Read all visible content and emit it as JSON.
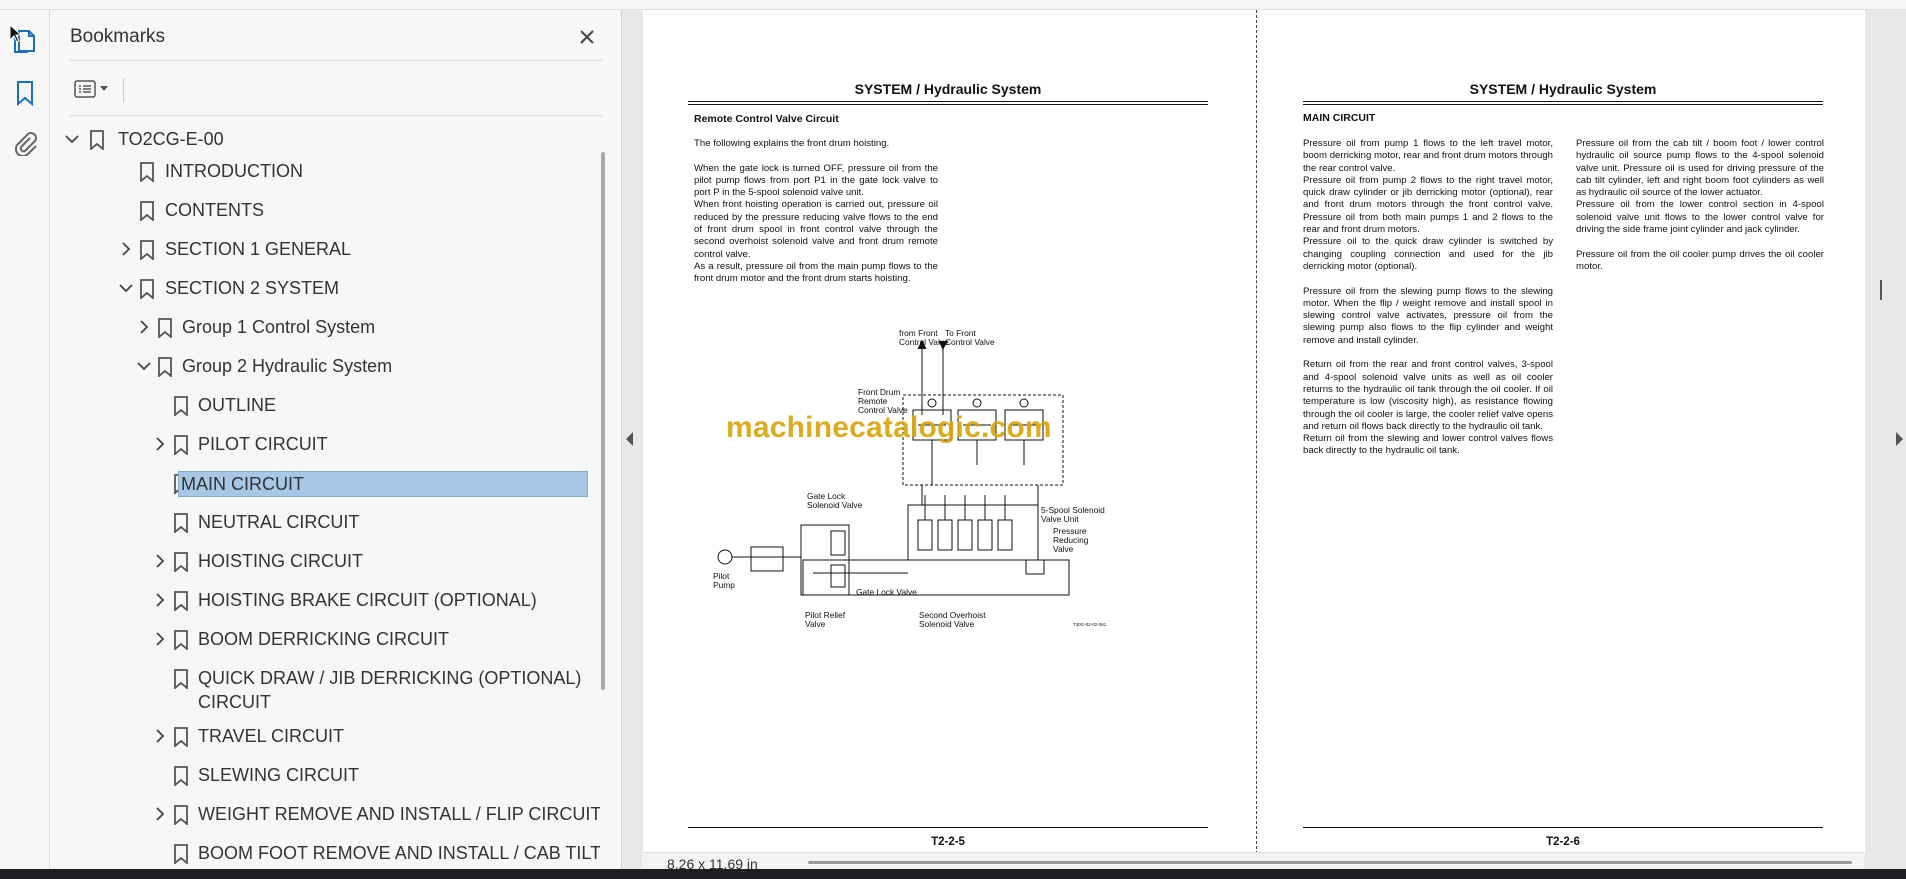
{
  "sidebar_panel": {
    "title": "Bookmarks",
    "root": "TO2CG-E-00",
    "items": [
      {
        "label": "INTRODUCTION",
        "level": 1,
        "expander": "none"
      },
      {
        "label": "CONTENTS",
        "level": 1,
        "expander": "none"
      },
      {
        "label": "SECTION 1 GENERAL",
        "level": 1,
        "expander": "collapsed"
      },
      {
        "label": "SECTION 2 SYSTEM",
        "level": 1,
        "expander": "expanded"
      },
      {
        "label": "Group 1 Control System",
        "level": 2,
        "expander": "collapsed"
      },
      {
        "label": "Group 2 Hydraulic System",
        "level": 2,
        "expander": "expanded"
      },
      {
        "label": "OUTLINE",
        "level": 3,
        "expander": "none"
      },
      {
        "label": "PILOT CIRCUIT",
        "level": 3,
        "expander": "collapsed"
      },
      {
        "label": "MAIN CIRCUIT",
        "level": 3,
        "expander": "none",
        "selected": true
      },
      {
        "label": "NEUTRAL CIRCUIT",
        "level": 3,
        "expander": "none"
      },
      {
        "label": "HOISTING CIRCUIT",
        "level": 3,
        "expander": "collapsed"
      },
      {
        "label": "HOISTING BRAKE CIRCUIT (OPTIONAL)",
        "level": 3,
        "expander": "collapsed"
      },
      {
        "label": "BOOM DERRICKING CIRCUIT",
        "level": 3,
        "expander": "collapsed"
      },
      {
        "label": "QUICK DRAW / JIB DERRICKING (OPTIONAL) CIRCUIT",
        "level": 3,
        "expander": "none"
      },
      {
        "label": "TRAVEL CIRCUIT",
        "level": 3,
        "expander": "collapsed"
      },
      {
        "label": "SLEWING CIRCUIT",
        "level": 3,
        "expander": "none"
      },
      {
        "label": "WEIGHT REMOVE AND INSTALL / FLIP CIRCUIT",
        "level": 3,
        "expander": "collapsed"
      },
      {
        "label": "BOOM FOOT REMOVE AND INSTALL / CAB TILT",
        "level": 3,
        "expander": "none"
      }
    ]
  },
  "document": {
    "left_page": {
      "header": "SYSTEM / Hydraulic System",
      "section_title": "Remote Control Valve Circuit",
      "paragraphs": [
        "The following explains the front drum hoisting.",
        "When the gate lock is turned OFF, pressure oil from the pilot pump flows from port P1 in the gate lock valve to port P in the 5-spool solenoid valve unit.",
        "When front hoisting operation is carried out, pressure oil reduced by the pressure reducing valve flows to the end of front drum spool in front control valve through the second overhoist solenoid valve and front drum remote control valve.",
        "As a result, pressure oil from the main pump flows to the front drum motor and the front drum starts hoisting."
      ],
      "diagram_labels": {
        "from_front": [
          "from Front",
          "Control Valve"
        ],
        "to_front": [
          "To Front",
          "Control Valve"
        ],
        "front_drum": [
          "Front Drum",
          "Remote",
          "Control Valve"
        ],
        "gate_lock_solenoid": [
          "Gate Lock",
          "Solenoid Valve"
        ],
        "spool_unit": [
          "5-Spool Solenoid",
          "Valve Unit"
        ],
        "pressure_reducing": [
          "Pressure",
          "Reducing",
          "Valve"
        ],
        "pilot_pump": [
          "Pilot",
          "Pump"
        ],
        "gate_lock_valve": "Gate Lock Valve",
        "pilot_relief": [
          "Pilot Relief",
          "Valve"
        ],
        "second_overhoist": [
          "Second Overhoist",
          "Solenoid Valve"
        ],
        "figure_code": "T30G-02-02-061"
      },
      "footer": "T2-2-5"
    },
    "right_page": {
      "header": "SYSTEM / Hydraulic System",
      "section_title": "MAIN CIRCUIT",
      "col1": [
        "Pressure oil from pump 1 flows to the left travel motor, boom derricking motor, rear and front drum motors through the rear control valve.",
        "Pressure oil from pump 2 flows to the right travel motor, quick draw cylinder or jib derricking motor (optional), rear and front drum motors through the front control valve. Pressure oil from both main pumps 1 and 2 flows to the rear and front drum motors.",
        "Pressure oil to the quick draw cylinder is switched by changing coupling connection and used for the jib derricking motor (optional).",
        "Pressure oil from the slewing pump flows to the slewing motor. When the flip / weight remove and install spool in slewing control valve activates, pressure oil from the slewing pump also flows to the flip cylinder and weight remove and install cylinder.",
        "Return oil from the rear and front control valves, 3-spool and 4-spool solenoid valve units as well as oil cooler returns to the hydraulic oil tank through the oil cooler. If oil temperature is low (viscosity high), as resistance flowing through the oil cooler is large, the cooler relief valve opens and return oil flows back directly to the hydraulic oil tank.",
        "Return oil from the slewing and lower control valves flows back directly to the hydraulic oil tank."
      ],
      "col2": [
        "Pressure oil from the cab tilt / boom foot / lower control hydraulic oil source pump flows to the 4-spool solenoid valve unit. Pressure oil is used for driving pressure of the cab tilt cylinder, left and right boom foot cylinders as well as hydraulic oil source of the lower actuator.",
        "Pressure oil from the lower control section in 4-spool solenoid valve unit flows to the lower control valve for driving the side frame joint cylinder and jack cylinder.",
        "Pressure oil from the oil cooler pump drives the oil cooler motor."
      ],
      "footer": "T2-2-6"
    },
    "watermark": "machinecatalogic.com"
  },
  "status": {
    "page_size": "8,26 x 11,69 in"
  },
  "icons": {
    "rail": [
      "pages-icon",
      "bookmark-icon",
      "attachment-icon"
    ],
    "accent": "#1a6fc4",
    "selection": "#a7c7e7"
  }
}
